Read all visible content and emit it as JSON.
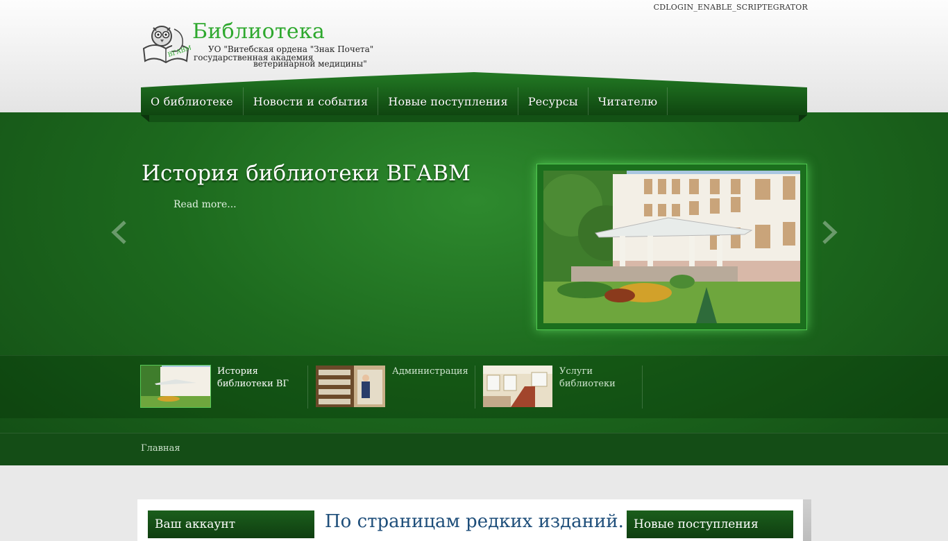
{
  "header": {
    "login_link": "CDLOGIN_ENABLE_SCRIPTEGRATOR",
    "logo_title": "Библиотека",
    "logo_sub": [
      "УО \"Витебская ордена \"Знак Почета\"",
      "государственная академия",
      "ветеринарной медицины\""
    ],
    "logo_badge": "ВГАВМ"
  },
  "nav": {
    "items": [
      {
        "label": "О библиотеке"
      },
      {
        "label": "Новости и события"
      },
      {
        "label": "Новые поступления"
      },
      {
        "label": "Ресурсы"
      },
      {
        "label": "Читателю"
      }
    ]
  },
  "slider": {
    "title": "История библиотеки ВГАВМ",
    "read_more": "Read more...",
    "prev_icon": "chevron-left-icon",
    "next_icon": "chevron-right-icon",
    "thumbs": [
      {
        "label": "История библиотеки ВГ",
        "active": true
      },
      {
        "label": "Администрация",
        "active": false
      },
      {
        "label": "Услуги библиотеки",
        "active": false
      }
    ]
  },
  "breadcrumb": {
    "home": "Главная"
  },
  "content": {
    "left_box_title": "Ваш аккаунт",
    "center_title": "По страницам редких изданий.",
    "right_box_title": "Новые поступления"
  },
  "colors": {
    "brand_green": "#2ea82e",
    "band_green": "#1d6a1e",
    "title_blue": "#1e4e7a"
  }
}
